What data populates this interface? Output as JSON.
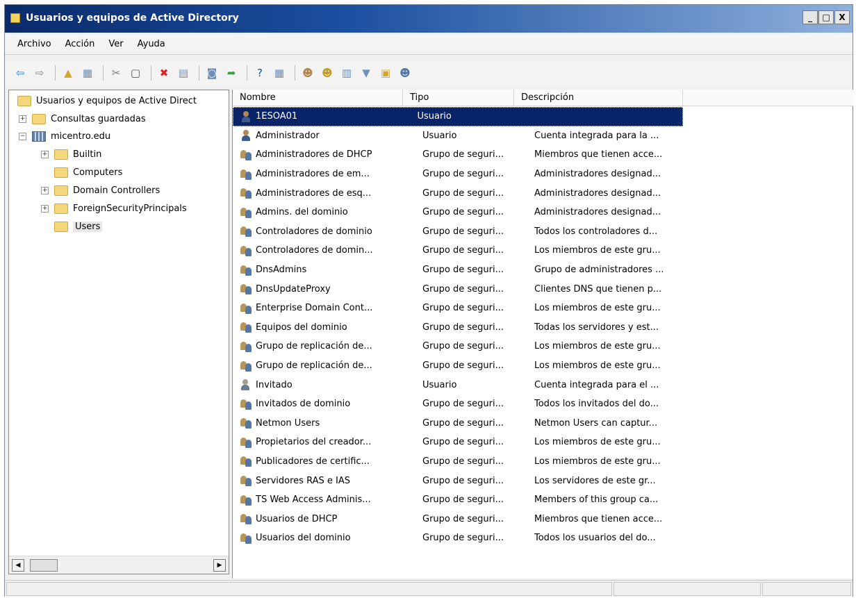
{
  "window": {
    "title": "Usuarios y equipos de Active Directory",
    "controls": [
      "_",
      "□",
      "X"
    ]
  },
  "menu": [
    "Archivo",
    "Acción",
    "Ver",
    "Ayuda"
  ],
  "toolbar": [
    {
      "icon": "back-arrow-icon",
      "glyph": "⇦",
      "color": "#2f7fd0"
    },
    {
      "icon": "forward-arrow-icon",
      "glyph": "⇨",
      "color": "#8a8a8a"
    },
    {
      "sep": true
    },
    {
      "icon": "up-folder-icon",
      "glyph": "▲",
      "color": "#d4a72c"
    },
    {
      "icon": "console-tree-icon",
      "glyph": "▦",
      "color": "#6c8fb6"
    },
    {
      "sep": true
    },
    {
      "icon": "cut-icon",
      "glyph": "✂",
      "color": "#7a7a7a"
    },
    {
      "icon": "copy-icon",
      "glyph": "▢",
      "color": "#555"
    },
    {
      "sep": true
    },
    {
      "icon": "delete-icon",
      "glyph": "✖",
      "color": "#e11f1f"
    },
    {
      "icon": "properties-icon",
      "glyph": "▤",
      "color": "#6f8fb8"
    },
    {
      "sep": true
    },
    {
      "icon": "refresh-icon",
      "glyph": "◙",
      "color": "#6f8fb8"
    },
    {
      "icon": "export-list-icon",
      "glyph": "➦",
      "color": "#3c9a3c"
    },
    {
      "sep": true
    },
    {
      "icon": "help-icon",
      "glyph": "?",
      "color": "#1b4fa0"
    },
    {
      "icon": "view-icon",
      "glyph": "▦",
      "color": "#6f8fb8"
    },
    {
      "sep": true
    },
    {
      "icon": "new-user-icon",
      "glyph": "☻",
      "color": "#b48550"
    },
    {
      "icon": "new-group-icon",
      "glyph": "☻",
      "color": "#c79a2c"
    },
    {
      "icon": "new-ou-icon",
      "glyph": "▥",
      "color": "#6f8fb8"
    },
    {
      "icon": "filter-icon",
      "glyph": "▼",
      "color": "#6f8fb8"
    },
    {
      "icon": "find-icon",
      "glyph": "▣",
      "color": "#d4a72c"
    },
    {
      "icon": "add-to-group-icon",
      "glyph": "☻",
      "color": "#5577a5"
    }
  ],
  "tree": {
    "root": "Usuarios y equipos de Active Direct",
    "items": [
      {
        "label": "Consultas guardadas",
        "expander": "+",
        "icon": "folder"
      },
      {
        "label": "micentro.edu",
        "expander": "−",
        "icon": "domain"
      },
      {
        "label": "Builtin",
        "expander": "+",
        "icon": "folder"
      },
      {
        "label": "Computers",
        "expander": "",
        "icon": "folder"
      },
      {
        "label": "Domain Controllers",
        "expander": "+",
        "icon": "folder"
      },
      {
        "label": "ForeignSecurityPrincipals",
        "expander": "+",
        "icon": "folder"
      },
      {
        "label": "Users",
        "expander": "",
        "icon": "folder",
        "selected": true
      }
    ]
  },
  "columns": [
    "Nombre",
    "Tipo",
    "Descripción"
  ],
  "rows": [
    {
      "name": "1ESOA01",
      "type": "Usuario",
      "desc": "",
      "icon": "user",
      "selected": true
    },
    {
      "name": "Administrador",
      "type": "Usuario",
      "desc": "Cuenta integrada para la ...",
      "icon": "user"
    },
    {
      "name": "Administradores de DHCP",
      "type": "Grupo de seguri...",
      "desc": "Miembros que tienen acce...",
      "icon": "group"
    },
    {
      "name": "Administradores de em...",
      "type": "Grupo de seguri...",
      "desc": "Administradores designad...",
      "icon": "group"
    },
    {
      "name": "Administradores de esq...",
      "type": "Grupo de seguri...",
      "desc": "Administradores designad...",
      "icon": "group"
    },
    {
      "name": "Admins. del dominio",
      "type": "Grupo de seguri...",
      "desc": "Administradores designad...",
      "icon": "group"
    },
    {
      "name": "Controladores de dominio",
      "type": "Grupo de seguri...",
      "desc": "Todos los controladores d...",
      "icon": "group"
    },
    {
      "name": "Controladores de domin...",
      "type": "Grupo de seguri...",
      "desc": "Los miembros de este gru...",
      "icon": "group"
    },
    {
      "name": "DnsAdmins",
      "type": "Grupo de seguri...",
      "desc": "Grupo de administradores ...",
      "icon": "group"
    },
    {
      "name": "DnsUpdateProxy",
      "type": "Grupo de seguri...",
      "desc": "Clientes DNS que tienen p...",
      "icon": "group"
    },
    {
      "name": "Enterprise Domain Cont...",
      "type": "Grupo de seguri...",
      "desc": "Los miembros de este gru...",
      "icon": "group"
    },
    {
      "name": "Equipos del dominio",
      "type": "Grupo de seguri...",
      "desc": "Todas los servidores y est...",
      "icon": "group"
    },
    {
      "name": "Grupo de replicación de...",
      "type": "Grupo de seguri...",
      "desc": "Los miembros de este gru...",
      "icon": "group"
    },
    {
      "name": "Grupo de replicación de...",
      "type": "Grupo de seguri...",
      "desc": "Los miembros de este gru...",
      "icon": "group"
    },
    {
      "name": "Invitado",
      "type": "Usuario",
      "desc": "Cuenta integrada para el ...",
      "icon": "guest"
    },
    {
      "name": "Invitados de dominio",
      "type": "Grupo de seguri...",
      "desc": "Todos los invitados del do...",
      "icon": "group"
    },
    {
      "name": "Netmon Users",
      "type": "Grupo de seguri...",
      "desc": "Netmon Users can captur...",
      "icon": "group"
    },
    {
      "name": "Propietarios del creador...",
      "type": "Grupo de seguri...",
      "desc": "Los miembros de este gru...",
      "icon": "group"
    },
    {
      "name": "Publicadores de certific...",
      "type": "Grupo de seguri...",
      "desc": "Los miembros de este gru...",
      "icon": "group"
    },
    {
      "name": "Servidores RAS e IAS",
      "type": "Grupo de seguri...",
      "desc": "Los servidores de este gr...",
      "icon": "group"
    },
    {
      "name": "TS Web Access Adminis...",
      "type": "Grupo de seguri...",
      "desc": "Members of this group ca...",
      "icon": "group"
    },
    {
      "name": "Usuarios de DHCP",
      "type": "Grupo de seguri...",
      "desc": "Miembros que tienen acce...",
      "icon": "group"
    },
    {
      "name": "Usuarios del dominio",
      "type": "Grupo de seguri...",
      "desc": "Todos los usuarios del do...",
      "icon": "group"
    }
  ],
  "colors": {
    "selection": "#0a246a",
    "title_start": "#0a2a6a",
    "title_end": "#8fb0dc"
  }
}
